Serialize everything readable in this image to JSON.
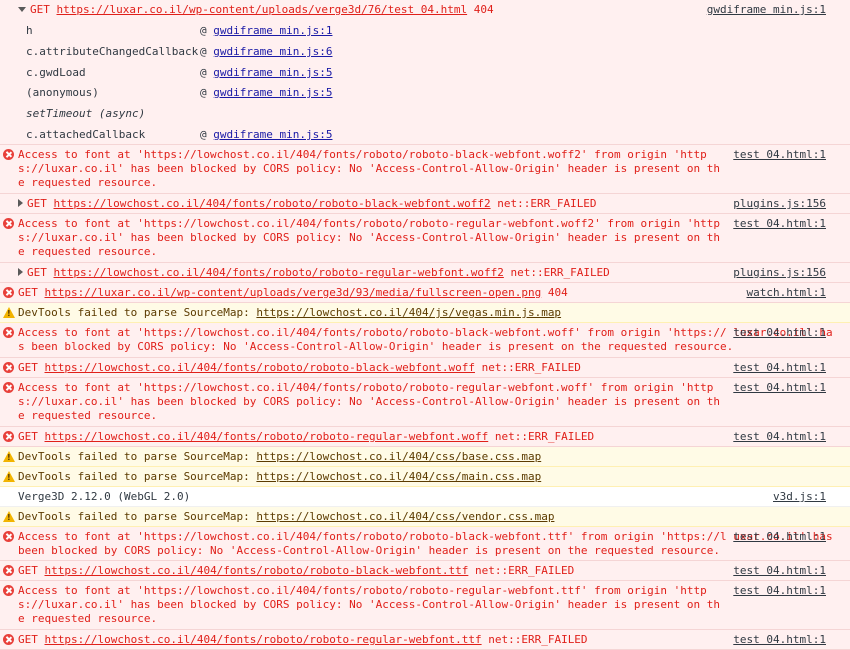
{
  "rows": [
    {
      "type": "error",
      "expanded": true,
      "method": "GET",
      "url": "https://luxar.co.il/wp-content/uploads/verge3d/76/test 04.html",
      "status": "404",
      "source": "gwdiframe min.js:1",
      "stack": [
        {
          "fn": "h",
          "at": "@",
          "link": "gwdiframe min.js:1"
        },
        {
          "fn": "c.attributeChangedCallback",
          "at": "@",
          "link": "gwdiframe min.js:6"
        },
        {
          "fn": "c.gwdLoad",
          "at": "@",
          "link": "gwdiframe min.js:5"
        },
        {
          "fn": "(anonymous)",
          "at": "@",
          "link": "gwdiframe min.js:5"
        },
        {
          "fn": "setTimeout (async)",
          "at": "",
          "link": ""
        },
        {
          "fn": "c.attachedCallback",
          "at": "@",
          "link": "gwdiframe min.js:5"
        }
      ]
    },
    {
      "type": "error",
      "text": "Access to font at 'https://lowchost.co.il/404/fonts/roboto/roboto-black-webfont.woff2' from origin 'http s://luxar.co.il' has been blocked by CORS policy: No 'Access-Control-Allow-Origin' header is present on the requested resource.",
      "source": "test 04.html:1"
    },
    {
      "type": "error",
      "collapsed": true,
      "method": "GET",
      "url": "https://lowchost.co.il/404/fonts/roboto/roboto-black-webfont.woff2",
      "status": "net::ERR_FAILED",
      "source": "plugins.js:156"
    },
    {
      "type": "error",
      "text": "Access to font at 'https://lowchost.co.il/404/fonts/roboto/roboto-regular-webfont.woff2' from origin 'http s://luxar.co.il' has been blocked by CORS policy: No 'Access-Control-Allow-Origin' header is present on the requested resource.",
      "source": "test 04.html:1"
    },
    {
      "type": "error",
      "collapsed": true,
      "method": "GET",
      "url": "https://lowchost.co.il/404/fonts/roboto/roboto-regular-webfont.woff2",
      "status": "net::ERR_FAILED",
      "source": "plugins.js:156"
    },
    {
      "type": "error",
      "method": "GET",
      "url": "https://luxar.co.il/wp-content/uploads/verge3d/93/media/fullscreen-open.png",
      "status": "404",
      "source": "watch.html:1"
    },
    {
      "type": "warn",
      "text": "DevTools failed to parse SourceMap:",
      "url": "https://lowchost.co.il/404/js/vegas.min.js.map"
    },
    {
      "type": "error",
      "text": "Access to font at 'https://lowchost.co.il/404/fonts/roboto/roboto-black-webfont.woff' from origin 'https:// luxar.co.il' has been blocked by CORS policy: No 'Access-Control-Allow-Origin' header is present on the requested resource.",
      "source": "test 04.html:1"
    },
    {
      "type": "error",
      "method": "GET",
      "url": "https://lowchost.co.il/404/fonts/roboto/roboto-black-webfont.woff",
      "status": "net::ERR_FAILED",
      "source": "test 04.html:1"
    },
    {
      "type": "error",
      "text": "Access to font at 'https://lowchost.co.il/404/fonts/roboto/roboto-regular-webfont.woff' from origin 'http s://luxar.co.il' has been blocked by CORS policy: No 'Access-Control-Allow-Origin' header is present on the requested resource.",
      "source": "test 04.html:1"
    },
    {
      "type": "error",
      "method": "GET",
      "url": "https://lowchost.co.il/404/fonts/roboto/roboto-regular-webfont.woff",
      "status": "net::ERR_FAILED",
      "source": "test 04.html:1"
    },
    {
      "type": "warn",
      "text": "DevTools failed to parse SourceMap:",
      "url": "https://lowchost.co.il/404/css/base.css.map"
    },
    {
      "type": "warn",
      "text": "DevTools failed to parse SourceMap:",
      "url": "https://lowchost.co.il/404/css/main.css.map"
    },
    {
      "type": "info",
      "text": "Verge3D 2.12.0 (WebGL 2.0)",
      "source": "v3d.js:1"
    },
    {
      "type": "warn",
      "text": "DevTools failed to parse SourceMap:",
      "url": "https://lowchost.co.il/404/css/vendor.css.map"
    },
    {
      "type": "error",
      "text": "Access to font at 'https://lowchost.co.il/404/fonts/roboto/roboto-black-webfont.ttf' from origin 'https://l uxar.co.il' has been blocked by CORS policy: No 'Access-Control-Allow-Origin' header is present on the requested resource.",
      "source": "test 04.html:1"
    },
    {
      "type": "error",
      "method": "GET",
      "url": "https://lowchost.co.il/404/fonts/roboto/roboto-black-webfont.ttf",
      "status": "net::ERR_FAILED",
      "source": "test 04.html:1"
    },
    {
      "type": "error",
      "text": "Access to font at 'https://lowchost.co.il/404/fonts/roboto/roboto-regular-webfont.ttf' from origin 'http s://luxar.co.il' has been blocked by CORS policy: No 'Access-Control-Allow-Origin' header is present on the requested resource.",
      "source": "test 04.html:1"
    },
    {
      "type": "error",
      "method": "GET",
      "url": "https://lowchost.co.il/404/fonts/roboto/roboto-regular-webfont.ttf",
      "status": "net::ERR_FAILED",
      "source": "test 04.html:1"
    }
  ]
}
